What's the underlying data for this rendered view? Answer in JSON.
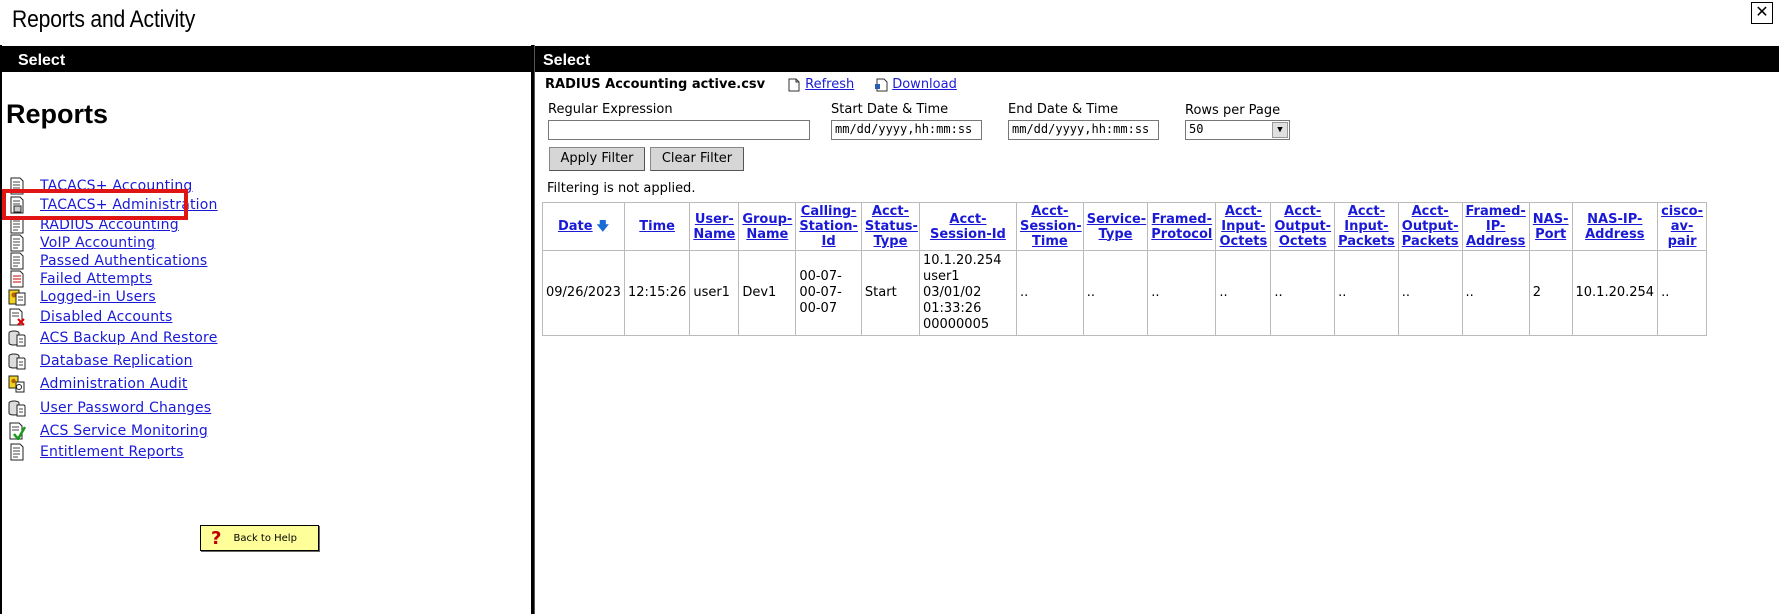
{
  "window": {
    "title": "Reports and Activity",
    "close_label": "✕"
  },
  "left": {
    "header": "Select",
    "heading": "Reports",
    "items": [
      {
        "label": "TACACS+ Accounting",
        "icon": "document-icon"
      },
      {
        "label": "TACACS+ Administration",
        "icon": "document-lock-icon"
      },
      {
        "label": "RADIUS Accounting",
        "icon": "document-icon"
      },
      {
        "label": "VoIP Accounting",
        "icon": "document-icon"
      },
      {
        "label": "Passed Authentications",
        "icon": "document-icon"
      },
      {
        "label": "Failed Attempts",
        "icon": "document-red-icon"
      },
      {
        "label": "Logged-in Users",
        "icon": "users-icon"
      },
      {
        "label": "Disabled Accounts",
        "icon": "document-x-icon"
      },
      {
        "label": "ACS Backup And Restore",
        "icon": "database-document-icon"
      },
      {
        "label": "Database Replication",
        "icon": "database-document-icon"
      },
      {
        "label": "Administration Audit",
        "icon": "admin-users-icon"
      },
      {
        "label": "User Password Changes",
        "icon": "database-document-icon"
      },
      {
        "label": "ACS Service Monitoring",
        "icon": "document-check-icon"
      },
      {
        "label": "Entitlement Reports",
        "icon": "document-icon"
      }
    ],
    "help_button": "Back to Help"
  },
  "right": {
    "header": "Select",
    "file_name": "RADIUS Accounting active.csv",
    "refresh_label": "Refresh",
    "download_label": "Download",
    "filter": {
      "regex_label": "Regular Expression",
      "regex_value": "",
      "start_label": "Start Date & Time",
      "start_value": "mm/dd/yyyy,hh:mm:ss",
      "end_label": "End Date & Time",
      "end_value": "mm/dd/yyyy,hh:mm:ss",
      "rows_label": "Rows per Page",
      "rows_value": "50",
      "apply_label": "Apply Filter",
      "clear_label": "Clear Filter"
    },
    "status": "Filtering is not applied.",
    "table": {
      "columns": [
        "Date",
        "Time",
        "User-Name",
        "Group-Name",
        "Calling-Station-Id",
        "Acct-Status-Type",
        "Acct-Session-Id",
        "Acct-Session-Time",
        "Service-Type",
        "Framed-Protocol",
        "Acct-Input-Octets",
        "Acct-Output-Octets",
        "Acct-Input-Packets",
        "Acct-Output-Packets",
        "Framed-IP-Address",
        "NAS-Port",
        "NAS-IP-Address",
        "cisco-av-pair"
      ],
      "rows": [
        [
          "09/26/2023",
          "12:15:26",
          "user1",
          "Dev1",
          "00-07-00-07-00-07",
          "Start",
          "10.1.20.254 user1 03/01/02 01:33:26 00000005",
          "..",
          "..",
          "..",
          "..",
          "..",
          "..",
          "..",
          "..",
          "2",
          "10.1.20.254",
          ".."
        ]
      ]
    }
  }
}
